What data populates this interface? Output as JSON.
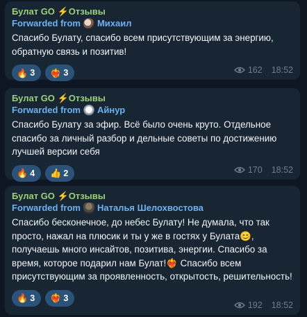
{
  "messages": [
    {
      "channel": "Булат GO",
      "channel_suffix": "Отзывы",
      "fwd_prefix": "Forwarded from",
      "author": "Михаил",
      "text": "Спасибо Булату, спасибо всем присутствующим за энергию, обратную связь и позитив!",
      "reactions": [
        {
          "emoji": "🔥",
          "count": "3"
        },
        {
          "emoji": "❤️‍🔥",
          "count": "3"
        }
      ],
      "views": "162",
      "time": "18:52"
    },
    {
      "channel": "Булат GO",
      "channel_suffix": "Отзывы",
      "fwd_prefix": "Forwarded from",
      "author": "Айнур",
      "text": "Спасибо Булату за эфир. Всё было очень круто. Отдельное спасибо за личный разбор и дельные советы по достижению лучшей версии себя",
      "reactions": [
        {
          "emoji": "🔥",
          "count": "4"
        },
        {
          "emoji": "👍",
          "count": "2"
        }
      ],
      "views": "170",
      "time": "18:52"
    },
    {
      "channel": "Булат GO",
      "channel_suffix": "Отзывы",
      "fwd_prefix": "Forwarded from",
      "author": "Наталья Шелохвостова",
      "text_part1": "Спасибо бесконечное, до небес Булату! Не думала, что так просто, нажал на плюсик и ты у же в гостях у Булата",
      "emoji_inline1": "😊",
      "text_part2": ", получаешь много инсайтов, позитива, энергии. Спасибо за время, которое подарил нам Булат!",
      "emoji_inline2": "❤️‍🔥",
      "text_part3": " Спасибо всем присутствующим за проявленность, открытость, решительность!",
      "reactions": [
        {
          "emoji": "🔥",
          "count": "3"
        },
        {
          "emoji": "❤️‍🔥",
          "count": "3"
        }
      ],
      "views": "192",
      "time": "18:52"
    }
  ]
}
